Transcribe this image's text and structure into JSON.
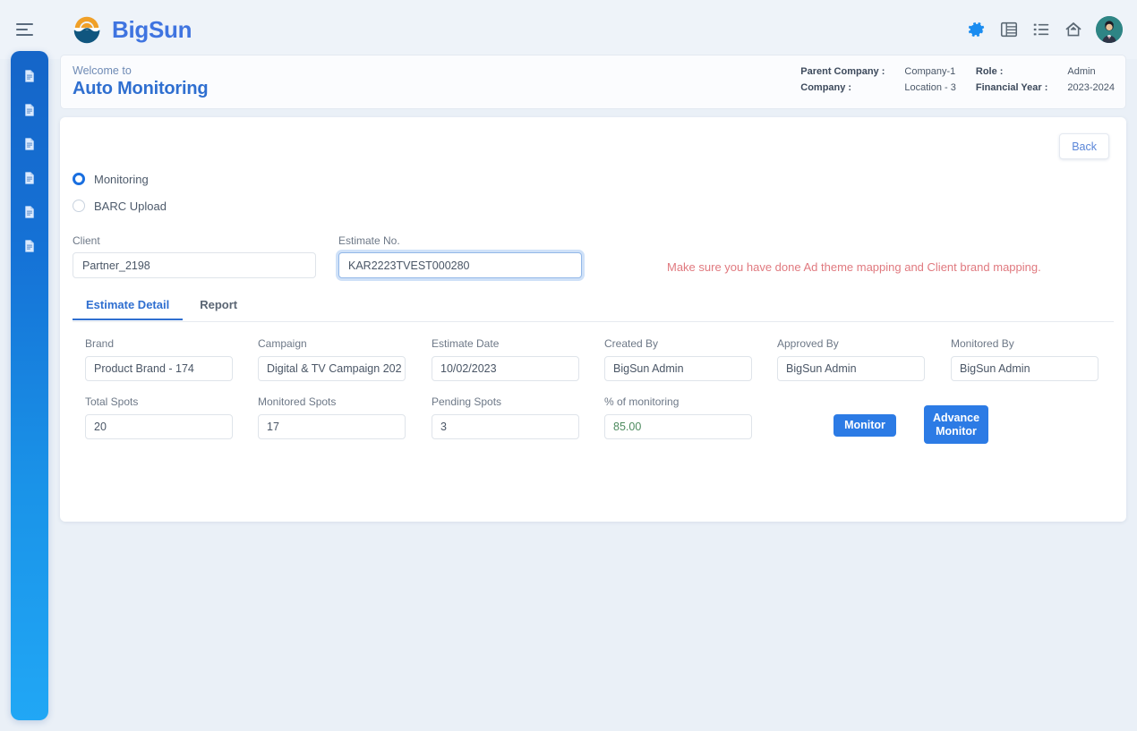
{
  "topbar": {
    "menu_icon": "hamburger-icon",
    "brand": "BigSun",
    "icons": [
      {
        "name": "gear-icon",
        "label": "Settings"
      },
      {
        "name": "grid-table-icon",
        "label": "Table view"
      },
      {
        "name": "list-icon",
        "label": "List view"
      },
      {
        "name": "home-icon",
        "label": "Home"
      }
    ],
    "avatar": "user-avatar"
  },
  "sidebar": {
    "items": [
      {
        "icon": "document-icon"
      },
      {
        "icon": "document-icon"
      },
      {
        "icon": "document-icon"
      },
      {
        "icon": "document-icon"
      },
      {
        "icon": "document-icon"
      },
      {
        "icon": "document-icon"
      }
    ]
  },
  "header": {
    "welcome": "Welcome to",
    "title": "Auto Monitoring",
    "meta": [
      {
        "key": "Parent Company :",
        "value": "Company-1"
      },
      {
        "key": "Role :",
        "value": "Admin"
      },
      {
        "key": "Company :",
        "value": "Location - 3"
      },
      {
        "key": "Financial Year :",
        "value": "2023-2024"
      }
    ]
  },
  "main": {
    "back_label": "Back",
    "mode_options": [
      {
        "label": "Monitoring",
        "selected": true
      },
      {
        "label": "BARC Upload",
        "selected": false
      }
    ],
    "client": {
      "label": "Client",
      "value": "Partner_2198",
      "placeholder": "Client"
    },
    "estimate_no": {
      "label": "Estimate No.",
      "value": "KAR2223TVEST000280",
      "placeholder": "Estimate No."
    },
    "warning": "Make sure you have done Ad theme mapping and Client brand mapping.",
    "tabs": [
      {
        "label": "Estimate Detail",
        "active": true
      },
      {
        "label": "Report",
        "active": false
      }
    ],
    "fields": {
      "brand": {
        "label": "Brand",
        "value": "Product Brand - 174"
      },
      "campaign": {
        "label": "Campaign",
        "value": "Digital & TV Campaign 202"
      },
      "estimate_date": {
        "label": "Estimate Date",
        "value": "10/02/2023"
      },
      "created_by": {
        "label": "Created By",
        "value": "BigSun Admin"
      },
      "approved_by": {
        "label": "Approved By",
        "value": "BigSun Admin"
      },
      "monitored_by": {
        "label": "Monitored By",
        "value": "BigSun Admin"
      },
      "total_spots": {
        "label": "Total Spots",
        "value": "20"
      },
      "monitored_spots": {
        "label": "Monitored Spots",
        "value": "17"
      },
      "pending_spots": {
        "label": "Pending Spots",
        "value": "3"
      },
      "pct_monitoring": {
        "label": "% of monitoring",
        "value": "85.00"
      }
    },
    "monitor_button": "Monitor",
    "advance_monitor_button": "Advance Monitor"
  },
  "colors": {
    "accent": "#2c7be5",
    "brand_blue": "#3f74e0",
    "warning_red": "#e0797f",
    "value_green": "#4c8a5e",
    "page_bg": "#eaf0f7"
  }
}
